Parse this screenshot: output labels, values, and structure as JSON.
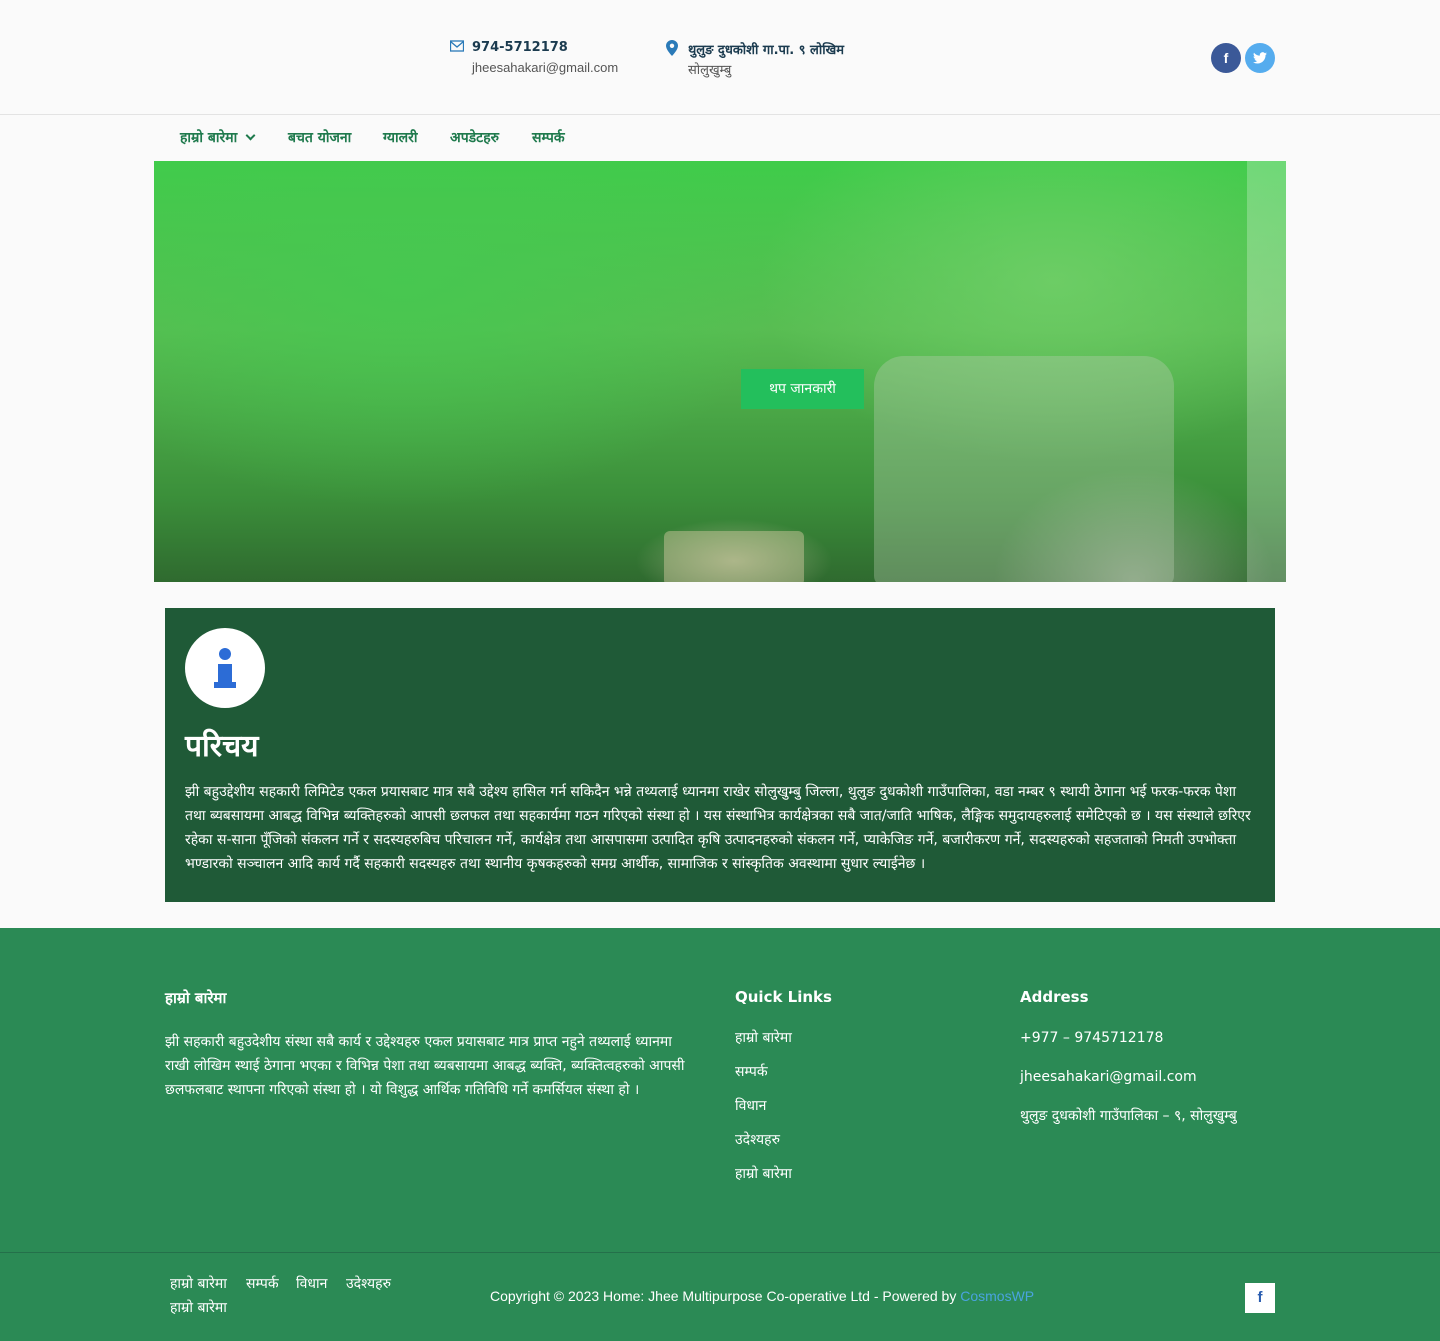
{
  "header": {
    "phone": "974-5712178",
    "email": "jheesahakari@gmail.com",
    "location_line1": "थुलुङ दुधकोशी गा.पा. ९ लोखिम",
    "location_line2": "सोलुखुम्बु",
    "social": [
      "facebook-icon",
      "twitter-icon"
    ],
    "social_glyphs": {
      "facebook": "f",
      "twitter": "t"
    }
  },
  "nav": {
    "items": [
      "हाम्रो बारेमा",
      "बचत योजना",
      "ग्यालरी",
      "अपडेटहरु",
      "सम्पर्क"
    ]
  },
  "hero": {
    "button_label": "थप जानकारी"
  },
  "intro": {
    "title": "परिचय",
    "body": "झी बहुउद्देशीय सहकारी लिमिटेड एकल प्रयासबाट मात्र सबै उद्देश्य हासिल गर्न सकिदैन भन्ने तथ्यलाई ध्यानमा राखेर सोलुखुम्बु जिल्ला, थुलुङ दुधकोशी गाउँपालिका, वडा नम्बर ९ स्थायी ठेगाना भई फरक-फरक पेशा तथा ब्यबसायमा आबद्ध विभिन्न ब्यक्तिहरुको आपसी छलफल तथा सहकार्यमा गठन गरिएको संस्था हो । यस संस्थाभित्र कार्यक्षेत्रका सबै जात/जाति भाषिक, लैङ्गिक समुदायहरुलाई समेटिएको छ । यस संस्थाले छरिएर रहेका स-साना पूँजिको संकलन गर्ने र सदस्यहरुबिच परिचालन गर्ने, कार्यक्षेत्र तथा आसपासमा उत्पादित कृषि उत्पादनहरुको संकलन गर्ने, प्याकेजिङ गर्ने, बजारीकरण गर्ने, सदस्यहरुको सहजताको निमती उपभोक्ता भण्डारको सञ्चालन आदि कार्य गर्दै सहकारी सदस्यहरु तथा स्थानीय कृषकहरुको समग्र आर्थीक, सामाजिक र सांस्कृतिक अवस्थामा सुधार ल्याईनेछ ।"
  },
  "footer": {
    "about_title": "हाम्रो बारेमा",
    "about_text": "झी सहकारी बहुउदेशीय संस्था सबै कार्य र उद्देश्यहरु एकल प्रयासबाट मात्र प्राप्त नहुने तथ्यलाई ध्यानमा राखी लोखिम स्थाई ठेगाना भएका र विभिन्न पेशा तथा ब्यबसायमा आबद्ध ब्यक्ति, ब्यक्तित्वहरुको आपसी छलफलबाट स्थापना गरिएको संस्था हो ।  यो विशुद्ध  आर्थिक गतिविधि गर्ने कमर्सियल संस्था  हो  ।",
    "quick_links_title": "Quick Links",
    "quick_links": [
      "हाम्रो बारेमा",
      "सम्पर्क",
      "विधान",
      "उदेश्यहरु",
      "हाम्रो बारेमा"
    ],
    "address_title": "Address",
    "address_phone": "+977 – 9745712178",
    "address_email": "jheesahakari@gmail.com",
    "address_location": "थुलुङ दुधकोशी गाउँपालिका – ९, सोलुखुम्बु"
  },
  "bottom": {
    "links": [
      "हाम्रो बारेमा",
      "सम्पर्क",
      "विधान",
      "उदेश्यहरु",
      "हाम्रो बारेमा"
    ],
    "copyright": "Copyright © 2023 Home: Jhee Multipurpose Co-operative Ltd - Powered by",
    "powered_by": "CosmosWP"
  },
  "colors": {
    "accent_green": "#23bf5c",
    "intro_bg": "#1f5a37",
    "footer_bg": "#2b8a55",
    "link_blue": "#4aa3df"
  }
}
